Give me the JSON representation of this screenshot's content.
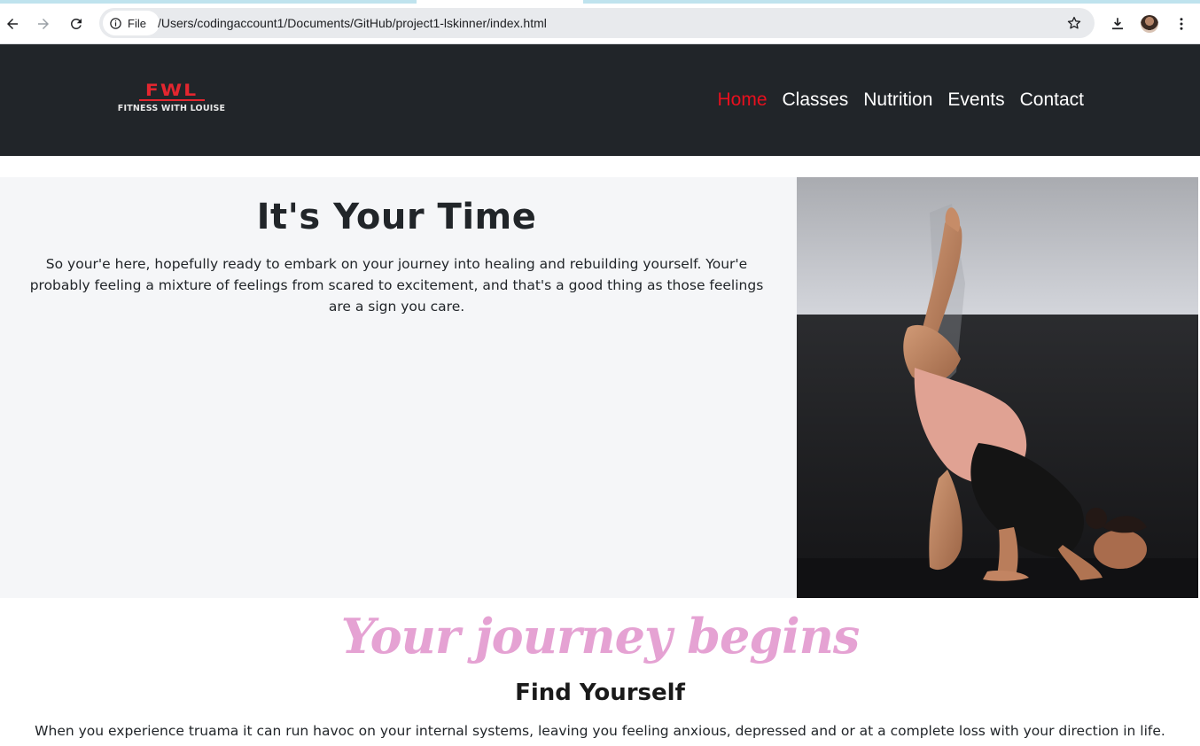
{
  "browser": {
    "omnibox_chip": "File",
    "url": "/Users/codingaccount1/Documents/GitHub/project1-lskinner/index.html"
  },
  "site": {
    "logo_mark": "FWL",
    "logo_tagline": "FITNESS WITH LOUISE",
    "nav": [
      {
        "label": "Home",
        "active": true
      },
      {
        "label": "Classes",
        "active": false
      },
      {
        "label": "Nutrition",
        "active": false
      },
      {
        "label": "Events",
        "active": false
      },
      {
        "label": "Contact",
        "active": false
      }
    ]
  },
  "hero": {
    "title": "It's Your Time",
    "text": "So your'e here, hopefully ready to embark on your journey into healing and rebuilding yourself. Your'e probably feeling a mixture of feelings from scared to excitement, and that's a good thing as those feelings are a sign you care."
  },
  "journey": {
    "script_title": "Your journey begins",
    "subtitle": "Find Yourself",
    "body": "When you experience truama it can run havoc on your internal systems, leaving you feeling anxious, depressed and or at a complete loss with your direction in life."
  },
  "colors": {
    "header_bg": "#212529",
    "nav_active": "#e8101e",
    "script_title": "#e5a2d3",
    "hero_bg": "#f5f6f8"
  }
}
